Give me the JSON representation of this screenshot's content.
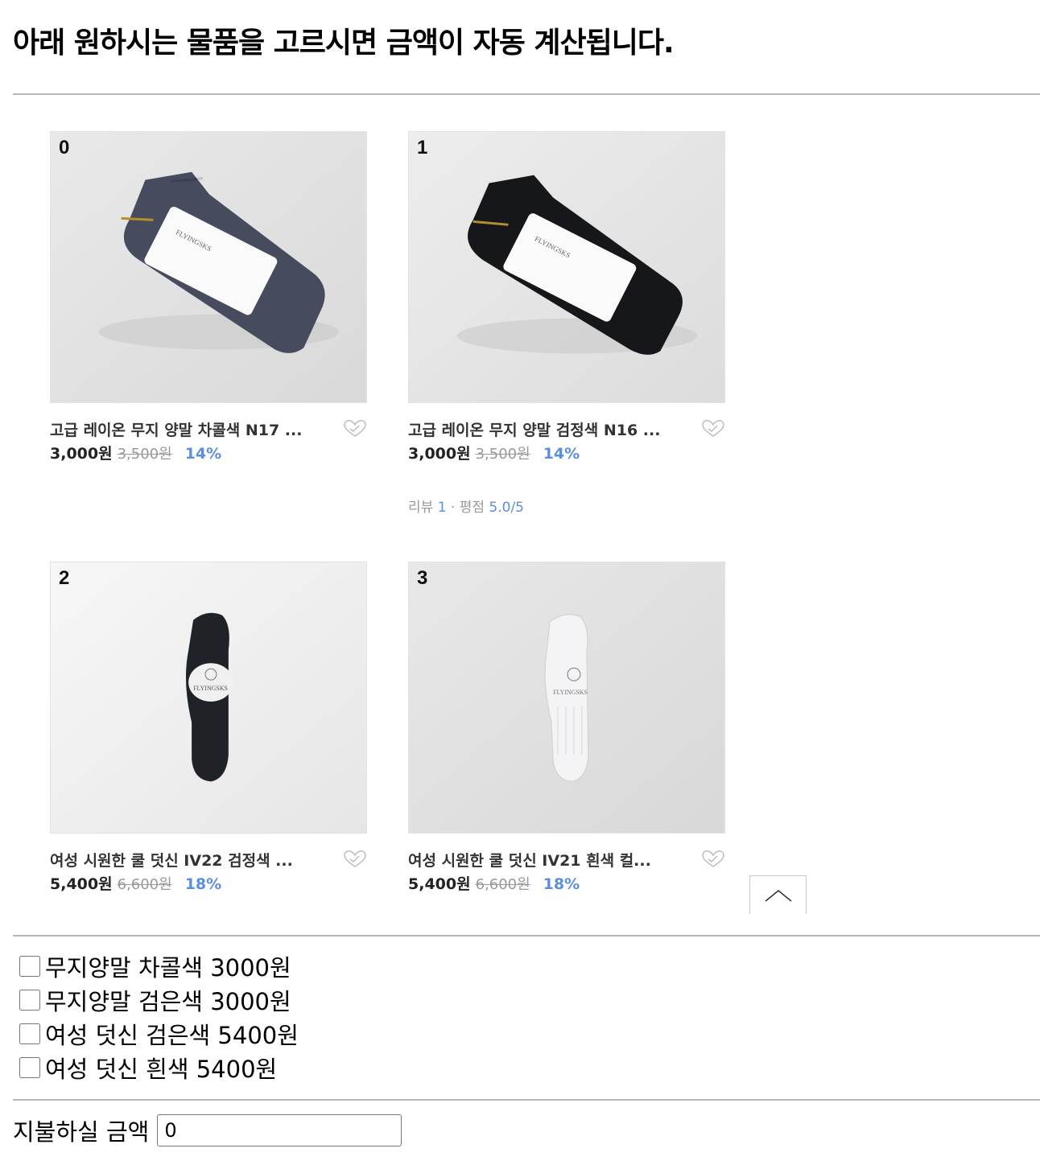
{
  "page": {
    "title": "아래 원하시는 물품을 고르시면 금액이 자동 계산됩니다."
  },
  "products": [
    {
      "index": "0",
      "name": "고급 레이온 무지 양말 차콜색 N17 ...",
      "price": "3,000원",
      "original_price": "3,500원",
      "discount": "14%",
      "image_color": "#474b5e",
      "icon": "heart-icon"
    },
    {
      "index": "1",
      "name": "고급 레이온 무지 양말 검정색 N16 ...",
      "price": "3,000원",
      "original_price": "3,500원",
      "discount": "14%",
      "image_color": "#16171b",
      "icon": "heart-icon",
      "review": {
        "label": "리뷰",
        "count": "1",
        "sep": "·",
        "rating_label": "평점",
        "rating": "5.0/5"
      }
    },
    {
      "index": "2",
      "name": "여성 시원한 쿨 덧신 IV22 검정색 ...",
      "price": "5,400원",
      "original_price": "6,600원",
      "discount": "18%",
      "image_color": "#1f2226",
      "icon": "heart-icon"
    },
    {
      "index": "3",
      "name": "여성 시원한 쿨 덧신 IV21 흰색 컬...",
      "price": "5,400원",
      "original_price": "6,600원",
      "discount": "18%",
      "image_color": "#f4f4f6",
      "icon": "heart-icon"
    }
  ],
  "scroll_top_button": {
    "icon": "chevron-up-icon"
  },
  "options": [
    {
      "label": "무지양말 차콜색 3000원",
      "checked": false
    },
    {
      "label": "무지양말 검은색 3000원",
      "checked": false
    },
    {
      "label": "여성 덧신 검은색 5400원",
      "checked": false
    },
    {
      "label": "여성 덧신 흰색 5400원",
      "checked": false
    }
  ],
  "total": {
    "label": "지불하실 금액",
    "value": "0"
  }
}
